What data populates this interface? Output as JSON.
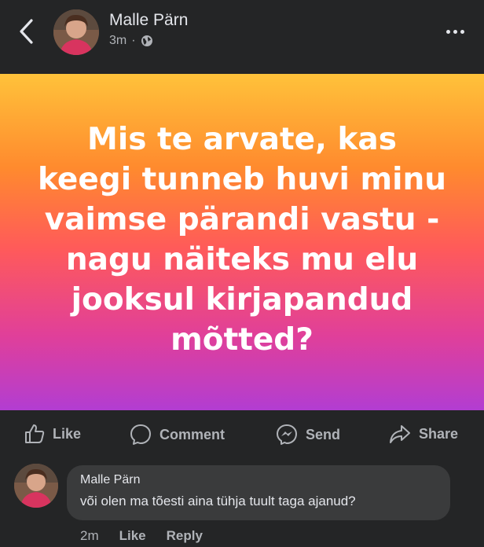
{
  "post": {
    "author": "Malle Pärn",
    "time": "3m",
    "separator": "·",
    "text": "Mis te arvate, kas keegi tunneb huvi minu vaimse pärandi vastu - nagu näiteks mu elu jooksul kirjapandud mõtted?",
    "gradient_colors": [
      "#ffc23a",
      "#ff8a2e",
      "#ff5a5a",
      "#e03f9a",
      "#b23dd2"
    ]
  },
  "actions": {
    "like": "Like",
    "comment": "Comment",
    "send": "Send",
    "share": "Share"
  },
  "comment": {
    "author": "Malle Pärn",
    "text": "või olen ma tõesti aina tühja tuult taga ajanud?",
    "time": "2m",
    "like": "Like",
    "reply": "Reply"
  },
  "icons": [
    "chevron-left-icon",
    "globe-icon",
    "more-icon",
    "like-icon",
    "comment-icon",
    "messenger-icon",
    "share-icon"
  ]
}
